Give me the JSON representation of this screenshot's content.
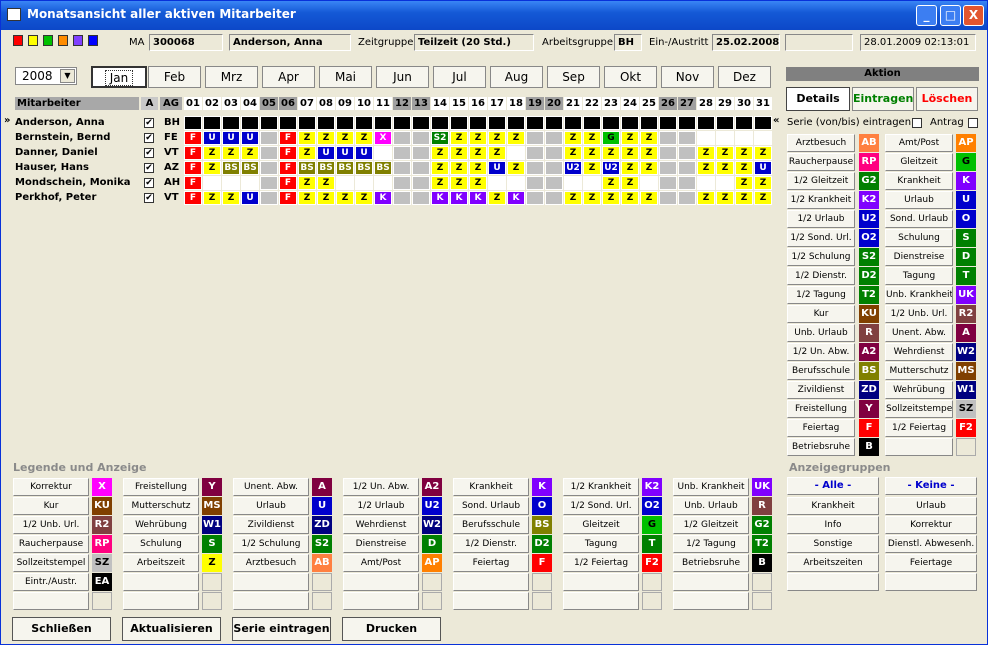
{
  "title": "Monatsansicht aller aktiven Mitarbeiter",
  "window": {
    "min": "_",
    "max": "□",
    "close": "X"
  },
  "swatches": [
    "#ff0000",
    "#ffff00",
    "#00c000",
    "#ff8c00",
    "#8040ff",
    "#0000ff"
  ],
  "top": {
    "ma_label": "MA",
    "ma_id": "300068",
    "ma_name": "Anderson, Anna",
    "zg_label": "Zeitgruppe",
    "zg": "Teilzeit (20 Std.)",
    "ag_label": "Arbeitsgruppe",
    "ag": "BH",
    "ea_label": "Ein-/Austritt",
    "ea": "25.02.2008",
    "blank": "",
    "datetime": "28.01.2009 02:13:01"
  },
  "year": "2008",
  "months": [
    "Jan",
    "Feb",
    "Mrz",
    "Apr",
    "Mai",
    "Jun",
    "Jul",
    "Aug",
    "Sep",
    "Okt",
    "Nov",
    "Dez"
  ],
  "grid": {
    "h_name": "Mitarbeiter",
    "h_a": "A",
    "h_ag": "AG",
    "days": [
      "01",
      "02",
      "03",
      "04",
      "05",
      "06",
      "07",
      "08",
      "09",
      "10",
      "11",
      "12",
      "13",
      "14",
      "15",
      "16",
      "17",
      "18",
      "19",
      "20",
      "21",
      "22",
      "23",
      "24",
      "25",
      "26",
      "27",
      "28",
      "29",
      "30",
      "31"
    ],
    "weekend": [
      4,
      5,
      11,
      12,
      18,
      19,
      25,
      26
    ],
    "rows": [
      {
        "name": "Anderson, Anna",
        "ag": "BH",
        "cells": [
          "B",
          "B",
          "B",
          "B",
          "B",
          "B",
          "B",
          "B",
          "B",
          "B",
          "B",
          "B",
          "B",
          "B",
          "B",
          "B",
          "B",
          "B",
          "B",
          "B",
          "B",
          "B",
          "B",
          "B",
          "B",
          "B",
          "B",
          "B",
          "B",
          "B",
          "B"
        ]
      },
      {
        "name": "Bernstein, Bernd",
        "ag": "FE",
        "cells": [
          "F",
          "U",
          "U",
          "U",
          "",
          "F",
          "Z",
          "Z",
          "Z",
          "Z",
          "X",
          "",
          "",
          "S2",
          "Z",
          "Z",
          "Z",
          "Z",
          "",
          "",
          "Z",
          "Z",
          "G",
          "Z",
          "Z",
          "",
          "",
          "",
          "",
          "",
          ""
        ]
      },
      {
        "name": "Danner, Daniel",
        "ag": "VT",
        "cells": [
          "F",
          "Z",
          "Z",
          "Z",
          "",
          "F",
          "Z",
          "U",
          "U",
          "U",
          "",
          "",
          "",
          "Z",
          "Z",
          "Z",
          "Z",
          "",
          "",
          "",
          "Z",
          "Z",
          "Z",
          "Z",
          "Z",
          "",
          "",
          "Z",
          "Z",
          "Z",
          "Z"
        ]
      },
      {
        "name": "Hauser, Hans",
        "ag": "AZ",
        "cells": [
          "F",
          "Z",
          "BS",
          "BS",
          "",
          "F",
          "BS",
          "BS",
          "BS",
          "BS",
          "BS",
          "",
          "",
          "Z",
          "Z",
          "Z",
          "U",
          "Z",
          "",
          "",
          "U2",
          "Z",
          "U2",
          "Z",
          "Z",
          "",
          "",
          "Z",
          "Z",
          "Z",
          "U"
        ]
      },
      {
        "name": "Mondschein, Monika",
        "ag": "AH",
        "cells": [
          "F",
          "",
          "",
          "",
          "",
          "F",
          "Z",
          "Z",
          "",
          "",
          "",
          "",
          "",
          "Z",
          "Z",
          "Z",
          "",
          "",
          "",
          "",
          "",
          "",
          "Z",
          "Z",
          "",
          "",
          "",
          "",
          "",
          "Z",
          "Z"
        ]
      },
      {
        "name": "Perkhof, Peter",
        "ag": "VT",
        "cells": [
          "F",
          "Z",
          "Z",
          "U",
          "",
          "F",
          "Z",
          "Z",
          "Z",
          "Z",
          "K",
          "",
          "",
          "K",
          "K",
          "K",
          "Z",
          "K",
          "",
          "",
          "Z",
          "Z",
          "Z",
          "Z",
          "Z",
          "",
          "",
          "Z",
          "Z",
          "Z",
          "Z"
        ]
      }
    ],
    "pointer": "»",
    "back": "«"
  },
  "aktion": {
    "header": "Aktion",
    "details": "Details",
    "eintragen": "Eintragen",
    "loeschen": "Löschen",
    "serie": "Serie (von/bis) eintragen",
    "antrag": "Antrag",
    "left": [
      [
        "Arztbesuch",
        "AB"
      ],
      [
        "Raucherpause",
        "RP"
      ],
      [
        "1/2 Gleitzeit",
        "G2"
      ],
      [
        "1/2 Krankheit",
        "K2"
      ],
      [
        "1/2 Urlaub",
        "U2"
      ],
      [
        "1/2 Sond. Url.",
        "O2"
      ],
      [
        "1/2 Schulung",
        "S2"
      ],
      [
        "1/2 Dienstr.",
        "D2"
      ],
      [
        "1/2 Tagung",
        "T2"
      ],
      [
        "Kur",
        "KU"
      ],
      [
        "Unb. Urlaub",
        "R"
      ],
      [
        "1/2 Un. Abw.",
        "A2"
      ],
      [
        "Berufsschule",
        "BS"
      ],
      [
        "Zivildienst",
        "ZD"
      ],
      [
        "Freistellung",
        "Y"
      ],
      [
        "Feiertag",
        "F"
      ],
      [
        "Betriebsruhe",
        "B"
      ]
    ],
    "right": [
      [
        "Amt/Post",
        "AP"
      ],
      [
        "Gleitzeit",
        "G"
      ],
      [
        "Krankheit",
        "K"
      ],
      [
        "Urlaub",
        "U"
      ],
      [
        "Sond. Urlaub",
        "O"
      ],
      [
        "Schulung",
        "S"
      ],
      [
        "Dienstreise",
        "D"
      ],
      [
        "Tagung",
        "T"
      ],
      [
        "Unb. Krankheit",
        "UK"
      ],
      [
        "1/2 Unb. Url.",
        "R2"
      ],
      [
        "Unent. Abw.",
        "A"
      ],
      [
        "Wehrdienst",
        "W2"
      ],
      [
        "Mutterschutz",
        "MS"
      ],
      [
        "Wehrübung",
        "W1"
      ],
      [
        "Sollzeitstempel",
        "SZ"
      ],
      [
        "1/2 Feiertag",
        "F2"
      ],
      [
        "",
        ""
      ]
    ]
  },
  "legend": {
    "title": "Legende und Anzeige",
    "cols": [
      [
        [
          "Korrektur",
          "X"
        ],
        [
          "Kur",
          "KU"
        ],
        [
          "1/2 Unb. Url.",
          "R2"
        ],
        [
          "Raucherpause",
          "RP"
        ],
        [
          "Sollzeitstempel",
          "SZ"
        ],
        [
          "Eintr./Austr.",
          "EA"
        ],
        [
          "",
          ""
        ]
      ],
      [
        [
          "Freistellung",
          "Y"
        ],
        [
          "Mutterschutz",
          "MS"
        ],
        [
          "Wehrübung",
          "W1"
        ],
        [
          "Schulung",
          "S"
        ],
        [
          "Arbeitszeit",
          "Z"
        ],
        [
          "",
          ""
        ],
        [
          "",
          ""
        ]
      ],
      [
        [
          "Unent. Abw.",
          "A"
        ],
        [
          "Urlaub",
          "U"
        ],
        [
          "Zivildienst",
          "ZD"
        ],
        [
          "1/2 Schulung",
          "S2"
        ],
        [
          "Arztbesuch",
          "AB"
        ],
        [
          "",
          ""
        ],
        [
          "",
          ""
        ]
      ],
      [
        [
          "1/2 Un. Abw.",
          "A2"
        ],
        [
          "1/2 Urlaub",
          "U2"
        ],
        [
          "Wehrdienst",
          "W2"
        ],
        [
          "Dienstreise",
          "D"
        ],
        [
          "Amt/Post",
          "AP"
        ],
        [
          "",
          ""
        ],
        [
          "",
          ""
        ]
      ],
      [
        [
          "Krankheit",
          "K"
        ],
        [
          "Sond. Urlaub",
          "O"
        ],
        [
          "Berufsschule",
          "BS"
        ],
        [
          "1/2 Dienstr.",
          "D2"
        ],
        [
          "Feiertag",
          "F"
        ],
        [
          "",
          ""
        ],
        [
          "",
          ""
        ]
      ],
      [
        [
          "1/2 Krankheit",
          "K2"
        ],
        [
          "1/2 Sond. Url.",
          "O2"
        ],
        [
          "Gleitzeit",
          "G"
        ],
        [
          "Tagung",
          "T"
        ],
        [
          "1/2 Feiertag",
          "F2"
        ],
        [
          "",
          ""
        ],
        [
          "",
          ""
        ]
      ],
      [
        [
          "Unb. Krankheit",
          "UK"
        ],
        [
          "Unb. Urlaub",
          "R"
        ],
        [
          "1/2 Gleitzeit",
          "G2"
        ],
        [
          "1/2 Tagung",
          "T2"
        ],
        [
          "Betriebsruhe",
          "B"
        ],
        [
          "",
          ""
        ],
        [
          "",
          ""
        ]
      ]
    ]
  },
  "gruppen": {
    "title": "Anzeigegruppen",
    "alle": "- Alle -",
    "keine": "- Keine -",
    "left": [
      "Krankheit",
      "Info",
      "Sonstige",
      "Arbeitszeiten",
      ""
    ],
    "right": [
      "Urlaub",
      "Korrektur",
      "Dienstl. Abwesenh.",
      "Feiertage",
      ""
    ]
  },
  "buttons": {
    "close": "Schließen",
    "refresh": "Aktualisieren",
    "serie": "Serie eintragen",
    "print": "Drucken"
  },
  "colors": {
    "F": "#ff0000",
    "U": "#0000cc",
    "Z": "#ffff00",
    "X": "#ff00ff",
    "S2": "#008000",
    "G": "#00c000",
    "BS": "#808000",
    "U2": "#0000cc",
    "K": "#8000ff",
    "B": "#000000",
    "AB": "#ff8040",
    "RP": "#ff0080",
    "G2": "#008000",
    "K2": "#8000ff",
    "O2": "#0000cc",
    "D2": "#008000",
    "T2": "#008000",
    "KU": "#804000",
    "R": "#804040",
    "A2": "#800040",
    "ZD": "#000080",
    "Y": "#800040",
    "AP": "#ff8000",
    "O": "#0000cc",
    "S": "#008000",
    "D": "#008000",
    "T": "#008000",
    "UK": "#8000ff",
    "R2": "#804040",
    "A": "#800040",
    "W2": "#000080",
    "MS": "#804000",
    "W1": "#000080",
    "SZ": "#c0c0c0",
    "F2": "#ff0000",
    "EA": "#000000"
  }
}
